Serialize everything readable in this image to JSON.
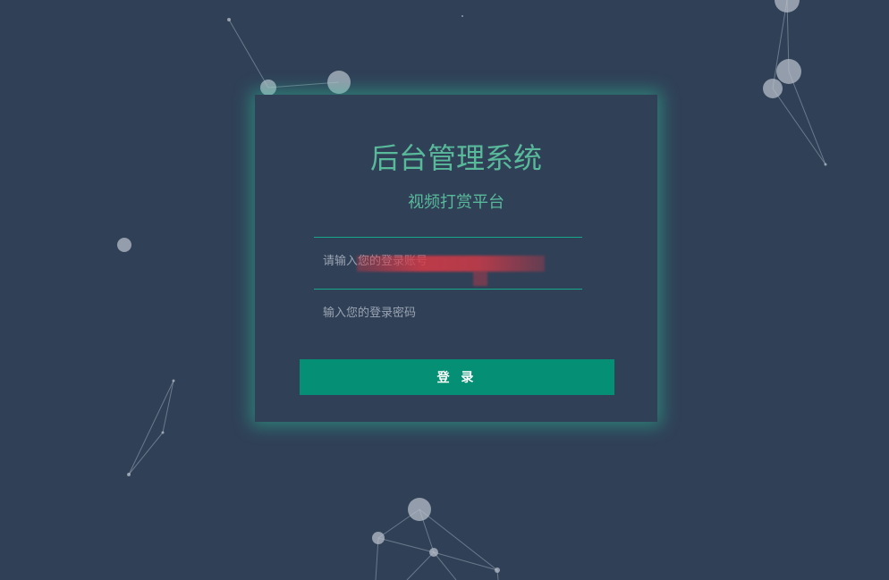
{
  "login": {
    "title": "后台管理系统",
    "subtitle": "视频打赏平台",
    "username_placeholder": "请输入您的登录账号",
    "password_placeholder": "输入您的登录密码",
    "login_label": "登 录"
  },
  "colors": {
    "background": "#304057",
    "accent": "#58b99b",
    "button": "#058f74",
    "input_line": "#14a888"
  }
}
